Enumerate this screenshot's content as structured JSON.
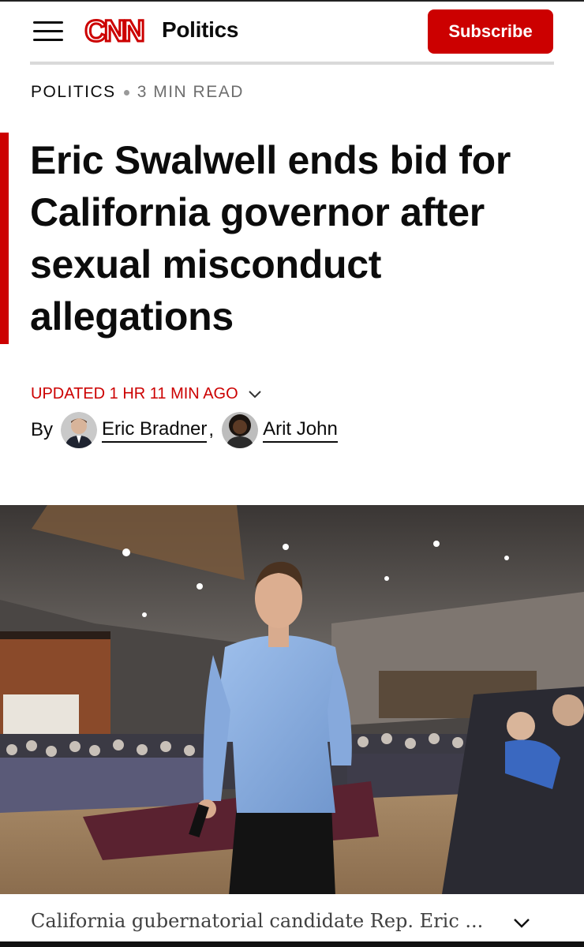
{
  "header": {
    "logo_text": "CNN",
    "section": "Politics",
    "subscribe_label": "Subscribe",
    "brand_color": "#cc0000"
  },
  "kicker": {
    "category": "POLITICS",
    "read_time": "3 MIN READ"
  },
  "article": {
    "headline": "Eric Swalwell ends bid for California governor after sexual misconduct allegations",
    "updated": "UPDATED 1 HR 11 MIN AGO",
    "by_label": "By",
    "authors": [
      {
        "name": "Eric Bradner"
      },
      {
        "name": "Arit John"
      }
    ],
    "author_separator": ","
  },
  "photo": {
    "caption": "California gubernatorial candidate Rep. Eric ..."
  },
  "icons": [
    "menu-icon",
    "cnn-logo",
    "chevron-down-icon",
    "author-avatar"
  ]
}
